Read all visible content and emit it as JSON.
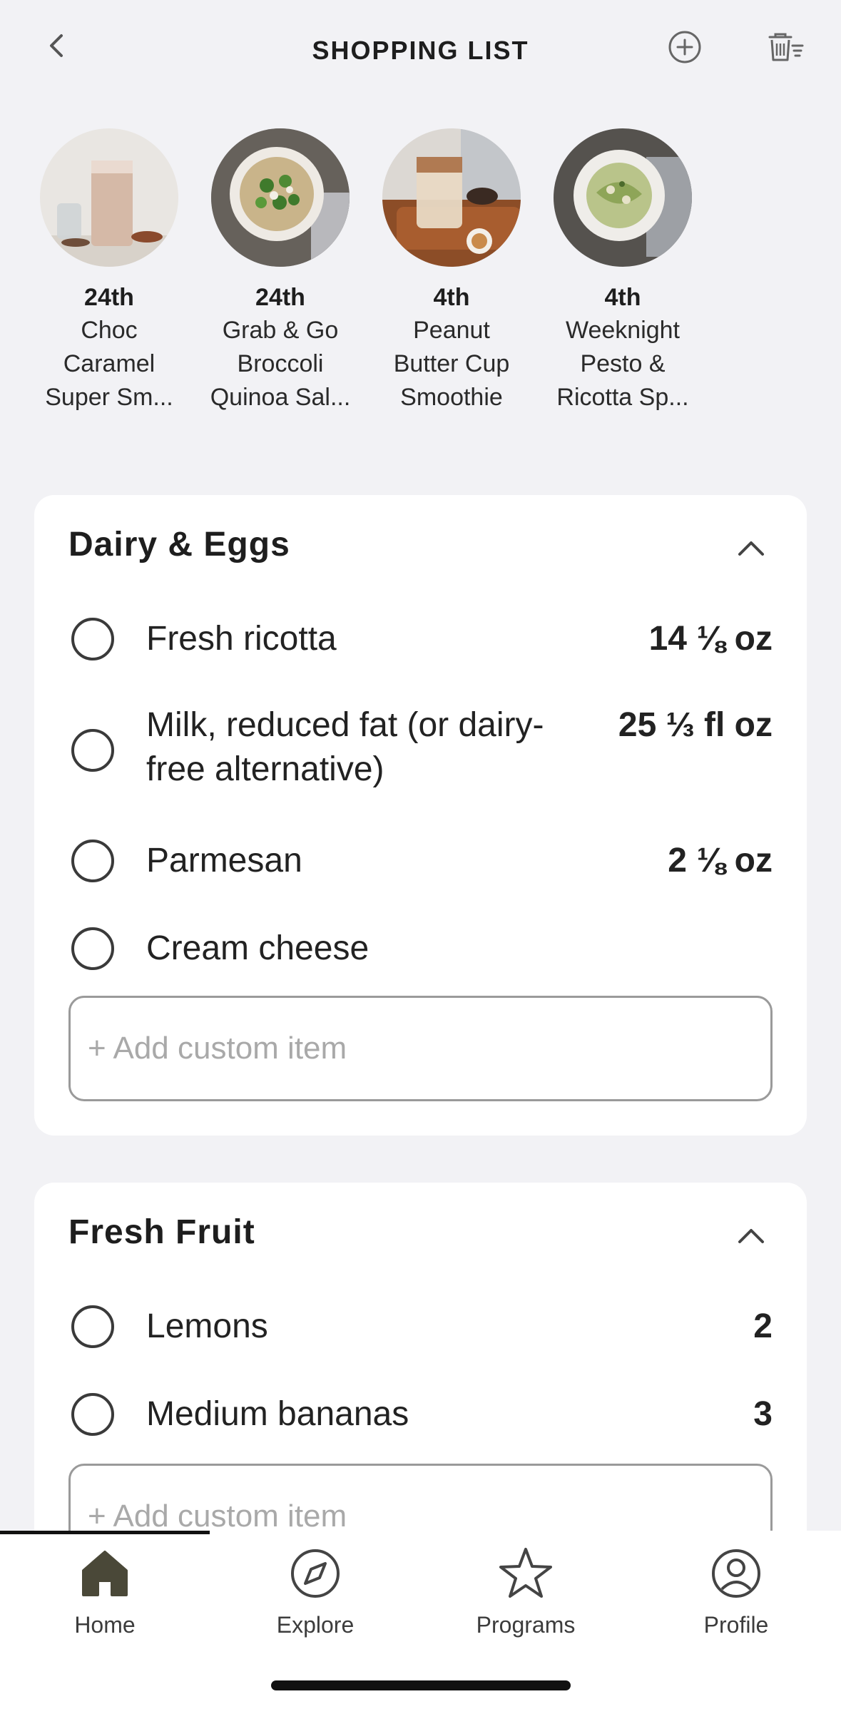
{
  "header": {
    "title": "SHOPPING LIST",
    "back_icon": "chevron-left-icon",
    "add_icon": "plus-circle-icon",
    "clear_icon": "trash-list-icon"
  },
  "recipes": [
    {
      "date": "24th",
      "name_lines": [
        "Choc",
        "Caramel",
        "Super Sm..."
      ]
    },
    {
      "date": "24th",
      "name_lines": [
        "Grab & Go",
        "Broccoli",
        "Quinoa Sal..."
      ]
    },
    {
      "date": "4th",
      "name_lines": [
        "Peanut",
        "Butter Cup",
        "Smoothie"
      ]
    },
    {
      "date": "4th",
      "name_lines": [
        "Weeknight",
        "Pesto &",
        "Ricotta Sp..."
      ]
    }
  ],
  "sections": [
    {
      "title": "Dairy & Eggs",
      "items": [
        {
          "label": "Fresh ricotta",
          "qty": "14 ⅛  oz"
        },
        {
          "label": "Milk, reduced fat (or dairy-free alternative)",
          "qty": "25 ⅓  fl oz"
        },
        {
          "label": "Parmesan",
          "qty": "2 ⅛  oz"
        },
        {
          "label": "Cream cheese",
          "qty": ""
        }
      ],
      "add_placeholder": "+ Add custom item"
    },
    {
      "title": "Fresh Fruit",
      "items": [
        {
          "label": "Lemons",
          "qty": "2"
        },
        {
          "label": "Medium bananas",
          "qty": "3"
        }
      ],
      "add_placeholder": "+ Add custom item"
    }
  ],
  "nav": {
    "items": [
      {
        "label": "Home",
        "icon": "home-icon",
        "active": true
      },
      {
        "label": "Explore",
        "icon": "compass-icon",
        "active": false
      },
      {
        "label": "Programs",
        "icon": "star-icon",
        "active": false
      },
      {
        "label": "Profile",
        "icon": "profile-icon",
        "active": false
      }
    ]
  },
  "colors": {
    "background": "#f2f2f5",
    "card": "#ffffff",
    "text": "#222222",
    "home_icon_fill": "#4a4838"
  }
}
